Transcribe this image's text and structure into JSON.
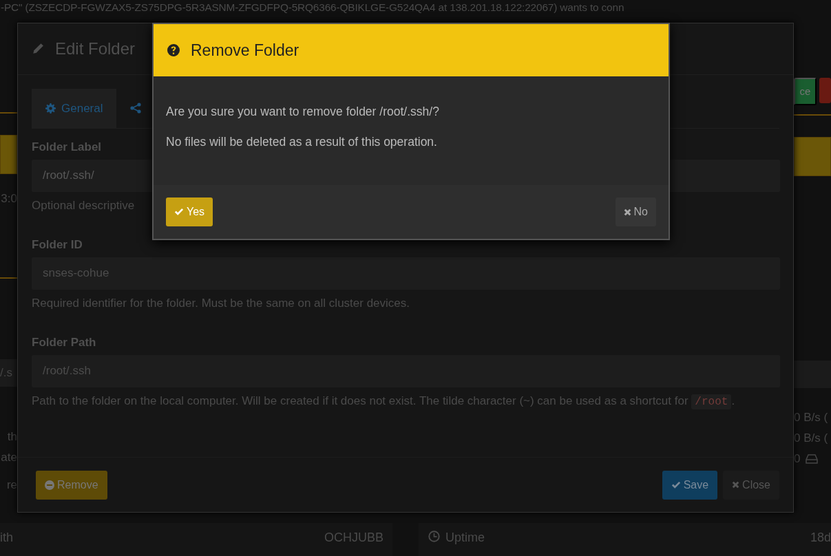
{
  "background": {
    "banner": "-PC\" (ZSZECDP-FGWZAX5-ZS75DPG-5R3ASNM-ZFGDFPQ-5RQ6366-QBIKLGE-G524QA4 at 138.201.18.122:22067) wants to conn",
    "left_fragments": [
      "3:0",
      "/.s",
      "th",
      "ate",
      "re"
    ],
    "right_button": "ce",
    "right_fragments": [
      {
        "text": "0 B/s (",
        "kind": "rate"
      },
      {
        "text": "0 B/s (",
        "kind": "rate"
      },
      {
        "text": "0",
        "kind": "disk"
      }
    ],
    "bottom_left": {
      "label": "ith",
      "value": "OCHJUBB"
    },
    "bottom_right": {
      "label": "Uptime",
      "value": "18d"
    }
  },
  "edit_folder": {
    "title": "Edit Folder",
    "tabs": [
      {
        "label": "General",
        "kind": "general",
        "selected": true
      },
      {
        "kind": "sharing",
        "selected": false
      }
    ],
    "fields": [
      {
        "label": "Folder Label",
        "value": "/root/.ssh/",
        "disabled": false,
        "help": "Optional descriptive"
      },
      {
        "label": "Folder ID",
        "value": "snses-cohue",
        "disabled": true,
        "help": "Required identifier for the folder. Must be the same on all cluster devices."
      },
      {
        "label": "Folder Path",
        "value": "/root/.ssh",
        "disabled": true,
        "help": "Path to the folder on the local computer. Will be created if it does not exist. The tilde character (~) can be used as a shortcut for",
        "help_code": "/root",
        "help_end": "."
      }
    ],
    "remove_button": "Remove",
    "save_button": "Save",
    "close_button": "Close"
  },
  "remove_dialog": {
    "title": "Remove Folder",
    "messages": [
      "Are you sure you want to remove folder /root/.ssh/?",
      "No files will be deleted as a result of this operation."
    ],
    "yes_button": "Yes",
    "no_button": "No"
  }
}
